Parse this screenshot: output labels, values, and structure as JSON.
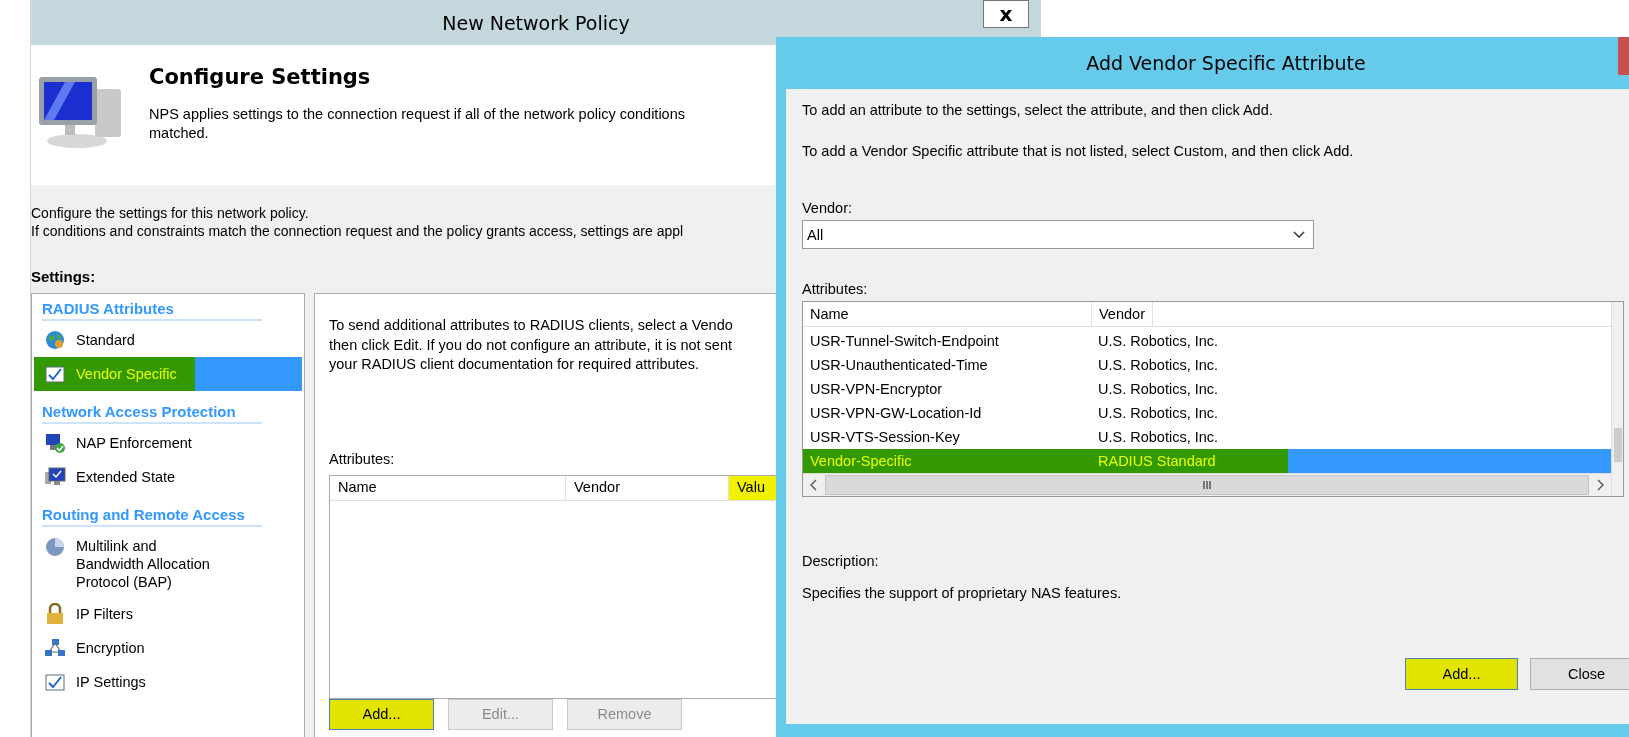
{
  "back_window": {
    "title": "New Network Policy",
    "close_glyph": "x",
    "header": {
      "title": "Configure Settings",
      "description_lines": [
        "NPS applies settings to the connection request if all of the network policy conditions",
        "matched."
      ]
    },
    "intro_lines": [
      "Configure the settings for this network policy.",
      "If conditions and constraints match the connection request and the policy grants access, settings are appl"
    ],
    "settings_label": "Settings:",
    "nav": [
      {
        "heading": "RADIUS Attributes",
        "items": [
          {
            "label": "Standard",
            "kind": "globe",
            "selected": false,
            "highlighted": false
          },
          {
            "label": "Vendor Specific",
            "kind": "check",
            "selected": true,
            "highlighted": true
          }
        ]
      },
      {
        "heading": "Network Access Protection",
        "items": [
          {
            "label": "NAP Enforcement",
            "kind": "computer",
            "selected": false,
            "highlighted": false
          },
          {
            "label": "Extended State",
            "kind": "monitor",
            "selected": false,
            "highlighted": false
          }
        ]
      },
      {
        "heading": "Routing and Remote Access",
        "items": [
          {
            "label": "Multilink and Bandwidth Allocation Protocol (BAP)",
            "kind": "disc",
            "selected": false,
            "highlighted": false
          },
          {
            "label": "IP Filters",
            "kind": "lock",
            "selected": false,
            "highlighted": false
          },
          {
            "label": "Encryption",
            "kind": "network",
            "selected": false,
            "highlighted": false
          },
          {
            "label": "IP Settings",
            "kind": "check",
            "selected": false,
            "highlighted": false
          }
        ]
      }
    ],
    "panel": {
      "text_lines": [
        "To send additional attributes to RADIUS clients, select a Vendo",
        "then click Edit. If you do not configure an attribute, it is not sent",
        "your RADIUS client documentation for required attributes."
      ],
      "attributes_label": "Attributes:",
      "columns": [
        {
          "label": "Name",
          "highlighted": false
        },
        {
          "label": "Vendor",
          "highlighted": false
        },
        {
          "label": "Valu",
          "highlighted": true
        }
      ],
      "buttons": [
        {
          "label": "Add...",
          "disabled": false,
          "highlighted": true
        },
        {
          "label": "Edit...",
          "disabled": true,
          "highlighted": false
        },
        {
          "label": "Remove",
          "disabled": true,
          "highlighted": false
        }
      ]
    }
  },
  "dialog": {
    "title": "Add Vendor Specific Attribute",
    "instructions": [
      "To add an attribute to the settings, select the attribute, and then click Add.",
      "To add a Vendor Specific attribute that is not listed, select Custom, and then click Add."
    ],
    "vendor_label": "Vendor:",
    "vendor_value": "All",
    "attributes_label": "Attributes:",
    "columns": [
      "Name",
      "Vendor"
    ],
    "rows": [
      {
        "name": "USR-Tunnel-Switch-Endpoint",
        "vendor": "U.S. Robotics, Inc.",
        "selected": false,
        "highlighted": false
      },
      {
        "name": "USR-Unauthenticated-Time",
        "vendor": "U.S. Robotics, Inc.",
        "selected": false,
        "highlighted": false
      },
      {
        "name": "USR-VPN-Encryptor",
        "vendor": "U.S. Robotics, Inc.",
        "selected": false,
        "highlighted": false
      },
      {
        "name": "USR-VPN-GW-Location-Id",
        "vendor": "U.S. Robotics, Inc.",
        "selected": false,
        "highlighted": false
      },
      {
        "name": "USR-VTS-Session-Key",
        "vendor": "U.S. Robotics, Inc.",
        "selected": false,
        "highlighted": false
      },
      {
        "name": "Vendor-Specific",
        "vendor": "RADIUS Standard",
        "selected": true,
        "highlighted": true
      }
    ],
    "description_label": "Description:",
    "description": "Specifies the support of proprietary NAS features.",
    "buttons": [
      {
        "label": "Add...",
        "highlighted": true
      },
      {
        "label": "Close",
        "highlighted": false
      }
    ]
  }
}
